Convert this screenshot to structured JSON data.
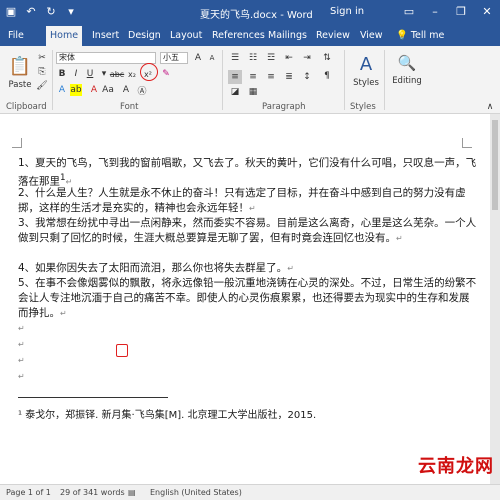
{
  "window": {
    "title": "夏天的飞鸟.docx - Word",
    "signin": "Sign in"
  },
  "tabs": [
    "File",
    "Home",
    "Insert",
    "Design",
    "Layout",
    "References",
    "Mailings",
    "Review",
    "View",
    "Tell me"
  ],
  "ribbon": {
    "paste_label": "Paste",
    "font_name": "宋体",
    "font_size": "小五",
    "styles_label": "Styles",
    "editing_label": "Editing",
    "groups": [
      "Clipboard",
      "Font",
      "Paragraph",
      "Styles"
    ]
  },
  "document": {
    "paragraphs": [
      "1、夏天的飞鸟，飞到我的窗前唱歌，又飞去了。秋天的黄叶，它们没有什么可唱，只叹息一声，飞落在那里",
      "2、什么是人生？人生就是永不休止的奋斗！只有选定了目标，并在奋斗中感到自己的努力没有虚掷，这样的生活才是充实的，精神也会永远年轻！",
      "3、我常想在纷扰中寻出一点闲静来，然而委实不容易。目前是这么离奇，心里是这么芜杂。一个人做到只剩了回忆的时候，生涯大概总要算是无聊了罢，但有时竟会连回忆也没有。",
      "4、如果你因失去了太阳而流泪，那么你也将失去群星了。",
      "5、在事不会像烟雾似的飘散，将永远像铅一般沉重地浇铸在心灵的深处。不过，日常生活的纷繁不会让人专注地沉湎于自己的痛苦不幸。即使人的心灵伤痕累累，也还得要去为现实中的生存和发展而挣扎。"
    ],
    "footnote_ref": "1",
    "footnote": "¹ 泰戈尔，郑振铎. 新月集·飞鸟集[M]. 北京理工大学出版社，2015."
  },
  "status": {
    "page": "Page 1 of 1",
    "words": "29 of 341 words",
    "language": "English (United States)"
  },
  "watermark": {
    "text": "云南龙网"
  },
  "icons": {
    "save": "save-icon",
    "undo": "undo-icon",
    "redo": "redo-icon",
    "paste": "paste-icon"
  },
  "colors": {
    "titlebar": "#2b579a",
    "highlight_circle": "#e02020"
  }
}
